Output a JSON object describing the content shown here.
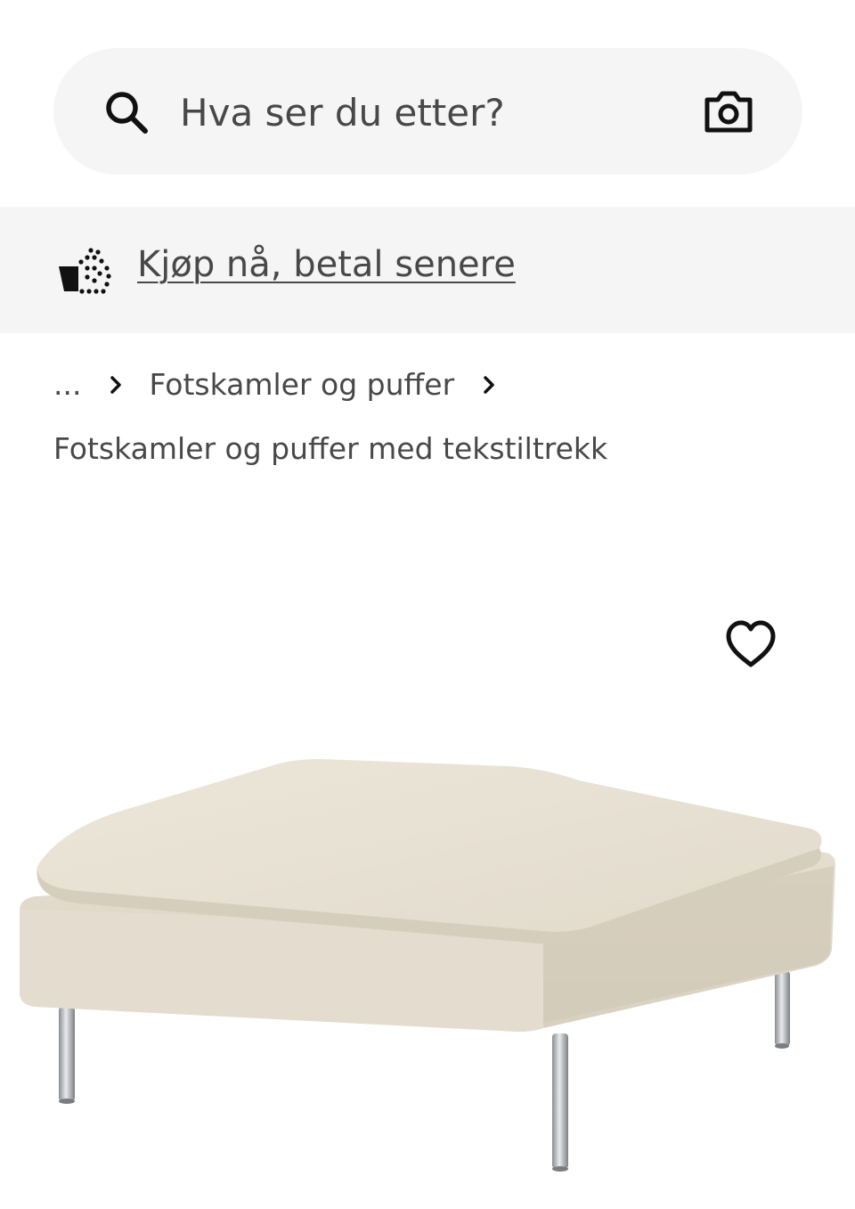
{
  "search": {
    "placeholder": "Hva ser du etter?",
    "icon": "search-icon",
    "camera_icon": "camera-icon"
  },
  "banner": {
    "icon": "buy-now-pay-later-icon",
    "link_text": "Kjøp nå, betal senere"
  },
  "breadcrumb": {
    "ellipsis": "...",
    "items": [
      {
        "label": "Fotskamler og puffer"
      }
    ],
    "separator_icon": "chevron-right-icon"
  },
  "page": {
    "title": "Fotskamler og puffer med tekstiltrekk"
  },
  "product": {
    "favourite_icon": "heart-icon",
    "image": "beige-upholstered-footstool-with-metal-legs"
  },
  "colors": {
    "background": "#ffffff",
    "surface": "#f5f5f5",
    "text": "#484848",
    "icon": "#111111",
    "fabric": "#e6dfd1"
  }
}
